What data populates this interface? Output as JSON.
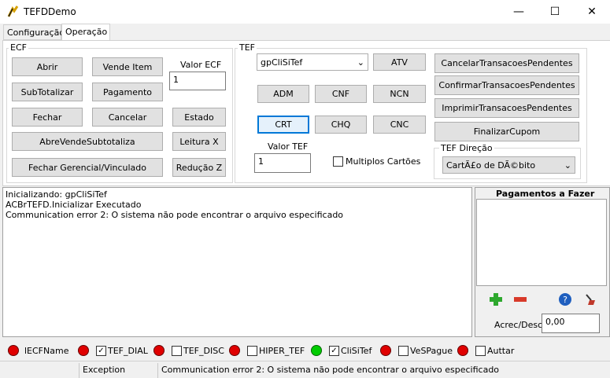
{
  "window": {
    "title": "TEFDDemo",
    "minimize": "—",
    "maximize": "☐",
    "close": "✕"
  },
  "tabs": [
    {
      "label": "Configuração"
    },
    {
      "label": "Operação"
    }
  ],
  "ecf": {
    "group_label": "ECF",
    "buttons": {
      "abrir": "Abrir",
      "vende_item": "Vende Item",
      "subtotalizar": "SubTotalizar",
      "pagamento": "Pagamento",
      "fechar": "Fechar",
      "cancelar": "Cancelar",
      "estado": "Estado",
      "abre_vende_subtotaliza": "AbreVendeSubtotaliza",
      "leitura_x": "Leitura X",
      "fechar_gerencial": "Fechar Gerencial/Vinculado",
      "reducao_z": "Redução Z"
    },
    "valor_label": "Valor ECF",
    "valor_value": "1"
  },
  "tef": {
    "group_label": "TEF",
    "gp_select": "gpCliSiTef",
    "buttons": {
      "atv": "ATV",
      "adm": "ADM",
      "cnf": "CNF",
      "ncn": "NCN",
      "crt": "CRT",
      "chq": "CHQ",
      "cnc": "CNC",
      "cancelar_pendentes": "CancelarTransacoesPendentes",
      "confirmar_pendentes": "ConfirmarTransacoesPendentes",
      "imprimir_pendentes": "ImprimirTransacoesPendentes",
      "finalizar_cupom": "FinalizarCupom"
    },
    "valor_label": "Valor TEF",
    "valor_value": "1",
    "multiplos_label": "Multiplos Cartões",
    "multiplos_checked": false,
    "direcao_label": "TEF Direção",
    "direcao_value": "CartÃ£o de DÃ©bito"
  },
  "log": {
    "lines": [
      "Inicializando: gpCliSiTef",
      "ACBrTEFD.Inicializar Executado",
      "Communication error 2: O sistema não pode encontrar o arquivo especificado"
    ]
  },
  "payments": {
    "title": "Pagamentos a Fazer",
    "acrec_label": "Acrec/Desc",
    "acrec_value": "0,00"
  },
  "status_leds": [
    {
      "label": "lECFName",
      "color": "red",
      "has_check": false,
      "checked": false
    },
    {
      "label": "TEF_DIAL",
      "color": "red",
      "has_check": true,
      "checked": true
    },
    {
      "label": "TEF_DISC",
      "color": "red",
      "has_check": true,
      "checked": false
    },
    {
      "label": "HIPER_TEF",
      "color": "red",
      "has_check": true,
      "checked": false
    },
    {
      "label": "CliSiTef",
      "color": "green",
      "has_check": true,
      "checked": true
    },
    {
      "label": "VeSPague",
      "color": "red",
      "has_check": true,
      "checked": false
    },
    {
      "label": "Auttar",
      "color": "red",
      "has_check": true,
      "checked": false
    }
  ],
  "statusbar": {
    "panel1": "Exception",
    "panel2": "Communication error 2: O sistema não pode encontrar o arquivo especificado"
  },
  "colors": {
    "led_red": "#e00000",
    "led_green": "#00cc00",
    "focus_blue": "#0078d7",
    "plus_green": "#2ea82e",
    "minus_red": "#d83a2a",
    "help_blue": "#1f5fbf"
  }
}
